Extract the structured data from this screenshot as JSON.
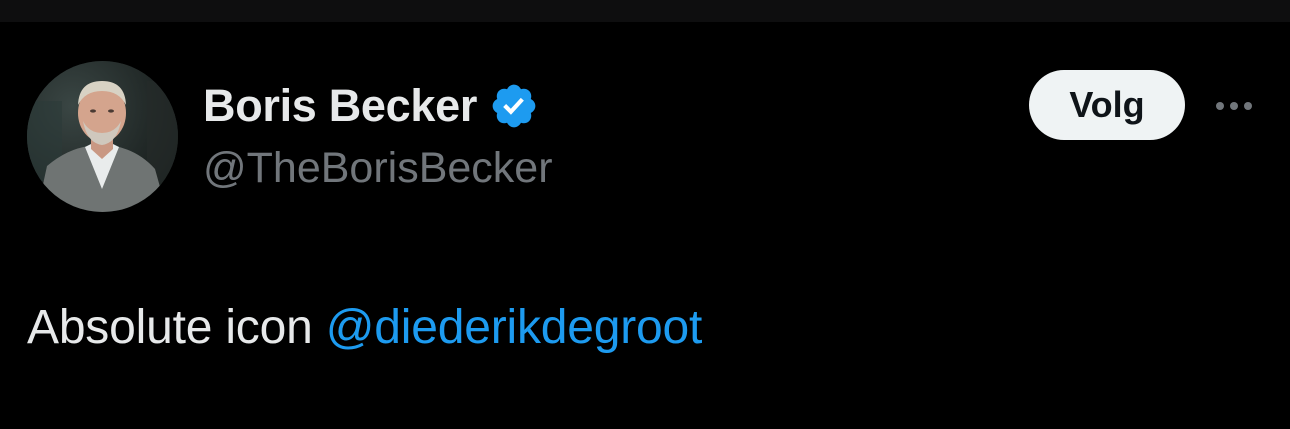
{
  "author": {
    "display_name": "Boris Becker",
    "handle": "@TheBorisBecker",
    "verified": true,
    "verified_icon": "verified-badge-icon",
    "verified_color": "#1d9bf0"
  },
  "actions": {
    "follow_label": "Volg",
    "more_icon": "more-horizontal-icon"
  },
  "tweet": {
    "text": "Absolute icon",
    "mention": "@diederikdegroot",
    "mention_color": "#1d9bf0"
  },
  "colors": {
    "background": "#000000",
    "primary_text": "#e7e9ea",
    "secondary_text": "#71767b",
    "button_bg": "#eff3f4"
  }
}
